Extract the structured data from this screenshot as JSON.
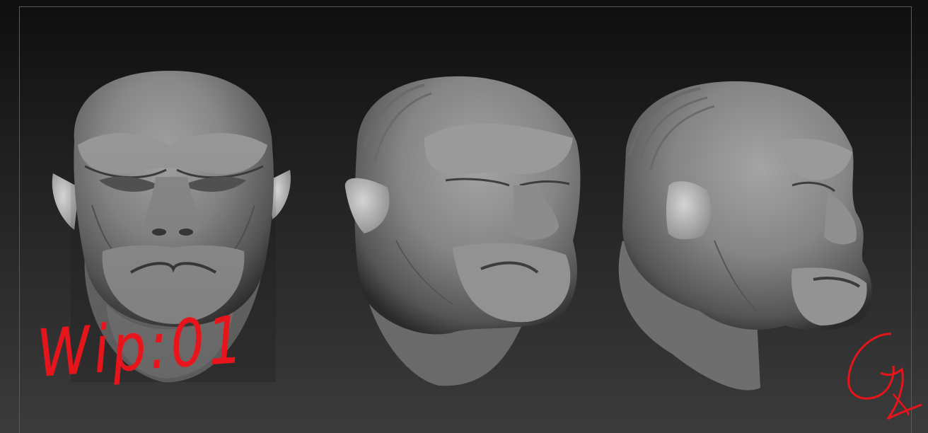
{
  "scene": {
    "title": "",
    "views": [
      {
        "name": "front-view"
      },
      {
        "name": "three-quarter-view"
      },
      {
        "name": "side-view"
      }
    ],
    "background_colors": [
      "#0f0f0f",
      "#3b3b3b"
    ],
    "frame_color": "#5a5a5a"
  },
  "annotation": {
    "wip_text": "Wip:01",
    "color": "#e8141c"
  },
  "signature": {
    "text": "Sy",
    "color": "#e8141c"
  }
}
